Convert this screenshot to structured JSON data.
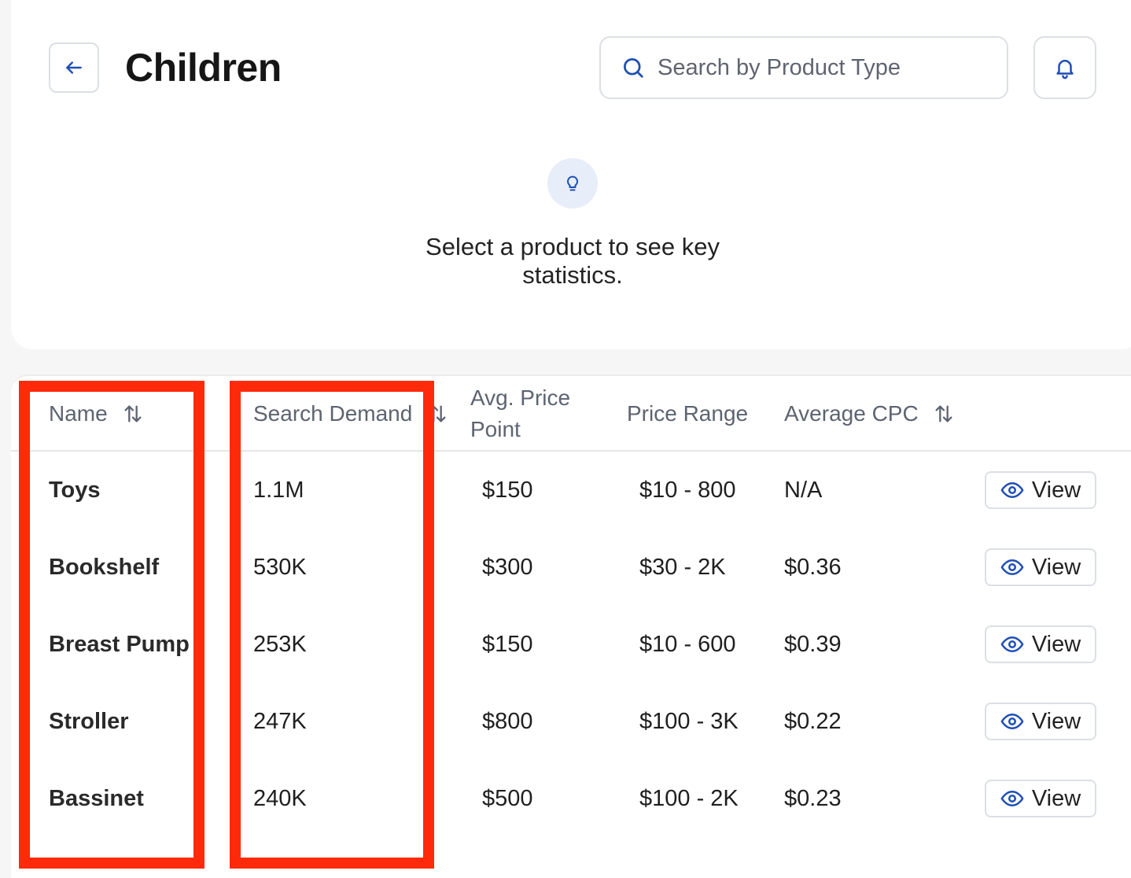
{
  "header": {
    "title": "Children",
    "search_placeholder": "Search by Product Type"
  },
  "tip": {
    "text": "Select a product to see key statistics."
  },
  "table": {
    "columns": {
      "name": "Name",
      "search_demand": "Search Demand",
      "avg_price_point": "Avg. Price Point",
      "price_range": "Price Range",
      "average_cpc": "Average CPC"
    },
    "view_label": "View",
    "rows": [
      {
        "name": "Toys",
        "search_demand": "1.1M",
        "avg_price": "$150",
        "price_range": "$10 - 800",
        "cpc": "N/A"
      },
      {
        "name": "Bookshelf",
        "search_demand": "530K",
        "avg_price": "$300",
        "price_range": "$30 - 2K",
        "cpc": "$0.36"
      },
      {
        "name": "Breast Pump",
        "search_demand": "253K",
        "avg_price": "$150",
        "price_range": "$10 - 600",
        "cpc": "$0.39"
      },
      {
        "name": "Stroller",
        "search_demand": "247K",
        "avg_price": "$800",
        "price_range": "$100 - 3K",
        "cpc": "$0.22"
      },
      {
        "name": "Bassinet",
        "search_demand": "240K",
        "avg_price": "$500",
        "price_range": "$100 - 2K",
        "cpc": "$0.23"
      }
    ]
  },
  "colors": {
    "accent": "#1f4fb5",
    "highlight": "#ff2a0a"
  }
}
